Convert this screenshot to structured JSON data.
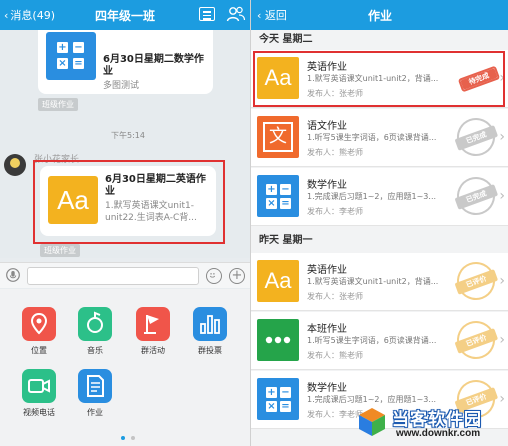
{
  "left": {
    "header": {
      "back_label": "消息(49)",
      "title": "四年级一班"
    },
    "top_card": {
      "title": "6月30日星期二数学作业",
      "desc": "多图测试"
    },
    "badge_1": "班级作业",
    "time": "下午5:14",
    "sender": "张小花家长",
    "english_card": {
      "tile_text": "Aa",
      "title": "6月30日星期二英语作业",
      "desc": "1.默写英语课文unit1-unit22.生词表A-C背..."
    },
    "badge_2": "班级作业",
    "apps": [
      {
        "label": "位置",
        "icon": "location-icon",
        "color": "#f0554a"
      },
      {
        "label": "音乐",
        "icon": "music-icon",
        "color": "#2cc089"
      },
      {
        "label": "群活动",
        "icon": "flag-icon",
        "color": "#f0554a"
      },
      {
        "label": "群投票",
        "icon": "bar-chart-icon",
        "color": "#2a8ee0"
      },
      {
        "label": "视频电话",
        "icon": "video-icon",
        "color": "#2cc089"
      },
      {
        "label": "作业",
        "icon": "document-icon",
        "color": "#2a8ee0"
      }
    ]
  },
  "right": {
    "header": {
      "back_label": "返回",
      "title": "作业"
    },
    "section_today": "今天  星期二",
    "section_yesterday": "昨天  星期一",
    "rows": [
      {
        "tile": "Aa",
        "icon": "english-icon",
        "title": "英语作业",
        "desc": "1.默写英语课文unit1-unit2，背诵...",
        "publisher": "发布人：张老师",
        "status": "待完成",
        "status_color": "#e7614d"
      },
      {
        "tile": "文",
        "icon": "chinese-icon",
        "title": "语文作业",
        "desc": "1.听写5课生字词语，6页读课背诵...",
        "publisher": "发布人：熊老师",
        "status": "已完成",
        "status_color": "#c9c9c9"
      },
      {
        "tile": "",
        "icon": "math-icon",
        "title": "数学作业",
        "desc": "1.完成课后习题1~2，应用题1~3...",
        "publisher": "发布人：李老师",
        "status": "已完成",
        "status_color": "#c9c9c9"
      },
      {
        "tile": "Aa",
        "icon": "english-icon",
        "title": "英语作业",
        "desc": "1.默写英语课文unit1-unit2，背诵...",
        "publisher": "发布人：张老师",
        "status": "已评价",
        "status_color": "#f4cf86"
      },
      {
        "tile": "",
        "icon": "dots-icon",
        "title": "本班作业",
        "desc": "1.听写5课生字词语，6页读课背诵...",
        "publisher": "发布人：熊老师",
        "status": "已评价",
        "status_color": "#f4cf86"
      },
      {
        "tile": "",
        "icon": "math-icon",
        "title": "数学作业",
        "desc": "1.完成课后习题1~2，应用题1~3...",
        "publisher": "发布人：李老师",
        "status": "已评价",
        "status_color": "#f4cf86"
      }
    ]
  },
  "watermark": {
    "name": "当客软件园",
    "url": "www.downkr.com"
  }
}
